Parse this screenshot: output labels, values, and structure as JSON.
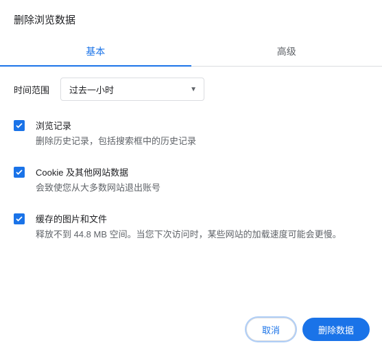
{
  "dialog": {
    "title": "删除浏览数据"
  },
  "tabs": {
    "basic": "基本",
    "advanced": "高级"
  },
  "time": {
    "label": "时间范围",
    "selected": "过去一小时"
  },
  "options": {
    "history": {
      "title": "浏览记录",
      "desc": "删除历史记录，包括搜索框中的历史记录"
    },
    "cookies": {
      "title": "Cookie 及其他网站数据",
      "desc": "会致使您从大多数网站退出账号"
    },
    "cache": {
      "title": "缓存的图片和文件",
      "desc": "释放不到 44.8 MB 空间。当您下次访问时，某些网站的加载速度可能会更慢。"
    }
  },
  "buttons": {
    "cancel": "取消",
    "confirm": "删除数据"
  }
}
